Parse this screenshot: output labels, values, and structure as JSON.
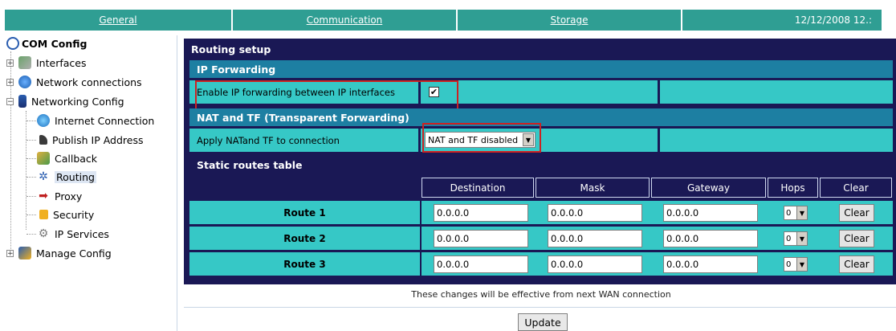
{
  "tabs": {
    "general": "General",
    "communication": "Communication",
    "storage": "Storage",
    "date": "12/12/2008 12.:"
  },
  "tree": {
    "root": "COM Config",
    "items": [
      {
        "label": "Interfaces",
        "icon": "interfaces-icon"
      },
      {
        "label": "Network connections",
        "icon": "network-icon"
      },
      {
        "label": "Networking Config",
        "icon": "networking-config-icon"
      },
      {
        "label": "Internet Connection",
        "icon": "internet-icon"
      },
      {
        "label": "Publish IP Address",
        "icon": "publish-icon"
      },
      {
        "label": "Callback",
        "icon": "callback-icon"
      },
      {
        "label": "Routing",
        "icon": "routing-icon"
      },
      {
        "label": "Proxy",
        "icon": "proxy-icon"
      },
      {
        "label": "Security",
        "icon": "lock-icon"
      },
      {
        "label": "IP Services",
        "icon": "gear-icon"
      },
      {
        "label": "Manage Config",
        "icon": "manage-config-icon"
      }
    ]
  },
  "panel": {
    "title": "Routing setup",
    "ip_forwarding": {
      "header": "IP Forwarding",
      "label": "Enable IP forwarding between IP interfaces",
      "checked_mark": "✔"
    },
    "nat": {
      "header": "NAT and TF (Transparent Forwarding)",
      "label": "Apply NATand TF to connection",
      "selected": "NAT and TF disabled"
    },
    "static_routes": {
      "header": "Static routes table",
      "columns": [
        "Destination",
        "Mask",
        "Gateway",
        "Hops",
        "Clear"
      ],
      "rows": [
        {
          "name": "Route 1",
          "destination": "0.0.0.0",
          "mask": "0.0.0.0",
          "gateway": "0.0.0.0",
          "hops": "0",
          "clear": "Clear"
        },
        {
          "name": "Route 2",
          "destination": "0.0.0.0",
          "mask": "0.0.0.0",
          "gateway": "0.0.0.0",
          "hops": "0",
          "clear": "Clear"
        },
        {
          "name": "Route 3",
          "destination": "0.0.0.0",
          "mask": "0.0.0.0",
          "gateway": "0.0.0.0",
          "hops": "0",
          "clear": "Clear"
        }
      ]
    }
  },
  "note": "These changes will be effective from next WAN connection",
  "update_label": "Update",
  "colors": {
    "tab": "#2f9e93",
    "panel_dark": "#1a1855",
    "section": "#1d7fa2",
    "cell": "#36c8c6",
    "highlight": "#cc2222"
  }
}
